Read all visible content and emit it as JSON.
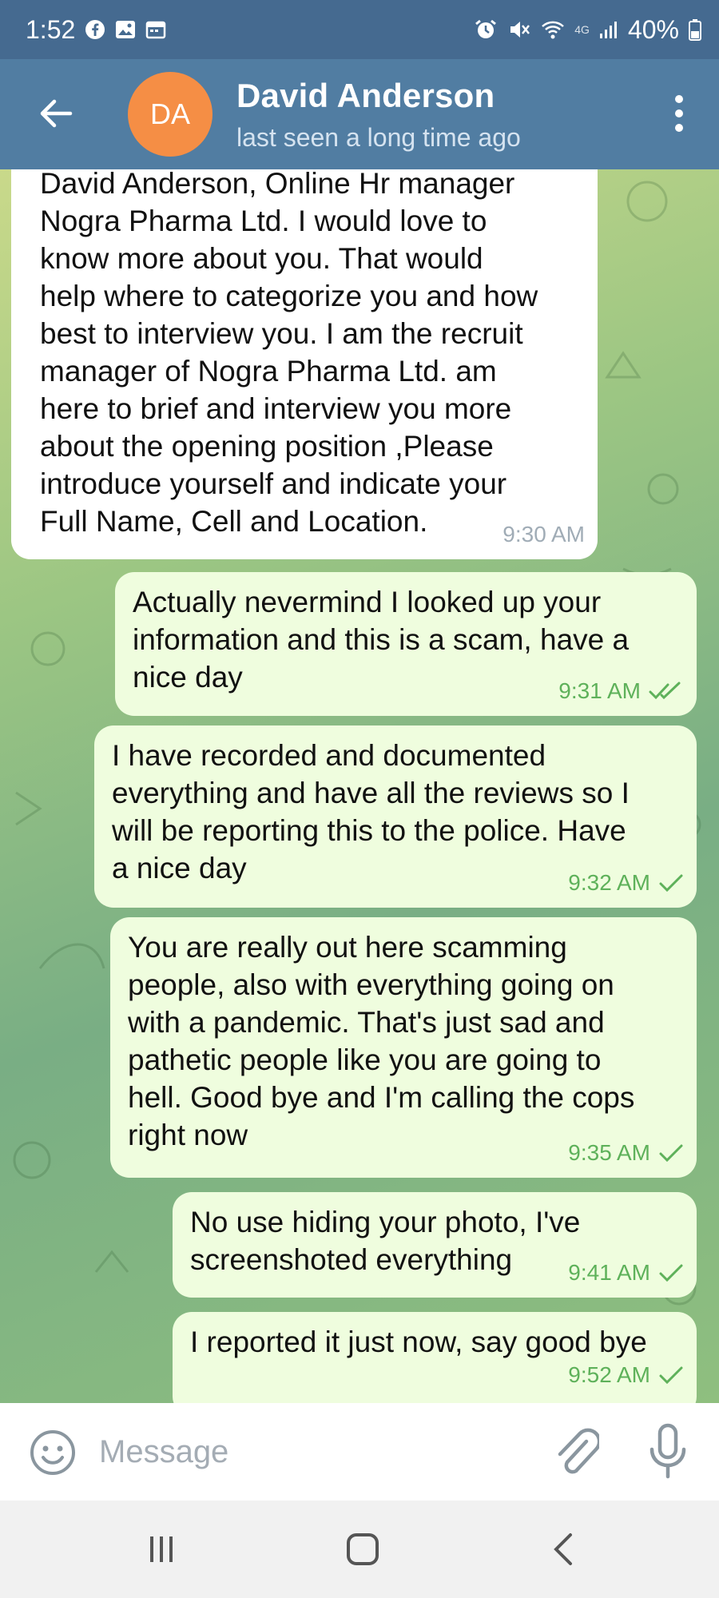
{
  "status_bar": {
    "time": "1:52",
    "network": "4G",
    "battery": "40%"
  },
  "header": {
    "avatar_initials": "DA",
    "contact_name": "David Anderson",
    "contact_status": "last seen a long time ago",
    "avatar_color": "#f58e45",
    "bar_color": "#517da2"
  },
  "messages": [
    {
      "direction": "incoming",
      "text": "David Anderson, Online Hr manager\nNogra Pharma Ltd. I would love to\nknow more about you. That would\nhelp where to categorize you and how\nbest to interview you. I am the recruit\nmanager of Nogra Pharma Ltd. am\nhere to brief and interview you more\nabout the opening position ,Please\nintroduce yourself and indicate your\nFull Name, Cell and Location.",
      "time": "9:30 AM"
    },
    {
      "direction": "outgoing",
      "text": "Actually nevermind I looked up your\ninformation and this is a scam, have a\nnice day",
      "time": "9:31 AM",
      "status": "read"
    },
    {
      "direction": "outgoing",
      "text": "I have recorded and documented\neverything and have all the reviews so I\nwill be reporting this to the police. Have\na nice day",
      "time": "9:32 AM",
      "status": "sent"
    },
    {
      "direction": "outgoing",
      "text": "You are really out here scamming\npeople, also with everything going on\nwith a pandemic. That's just sad and\npathetic people like you are going to\nhell. Good bye and I'm calling the cops\nright now",
      "time": "9:35 AM",
      "status": "sent"
    },
    {
      "direction": "outgoing",
      "text": "No use hiding your photo, I've\nscreenshoted everything",
      "time": "9:41 AM",
      "status": "sent"
    },
    {
      "direction": "outgoing",
      "text": "I reported it just now, say good bye",
      "time": "9:52 AM",
      "status": "sent"
    }
  ],
  "input": {
    "placeholder": "Message"
  },
  "icons": {
    "back": "arrow-left-icon",
    "menu": "more-vertical-icon",
    "emoji": "smile-icon",
    "attach": "paperclip-icon",
    "mic": "microphone-icon",
    "nav_recents": "recents-icon",
    "nav_home": "home-icon",
    "nav_back": "back-chevron-icon"
  },
  "colors": {
    "incoming_bubble": "#ffffff",
    "outgoing_bubble": "#effdde",
    "check_color": "#5eb15a"
  }
}
